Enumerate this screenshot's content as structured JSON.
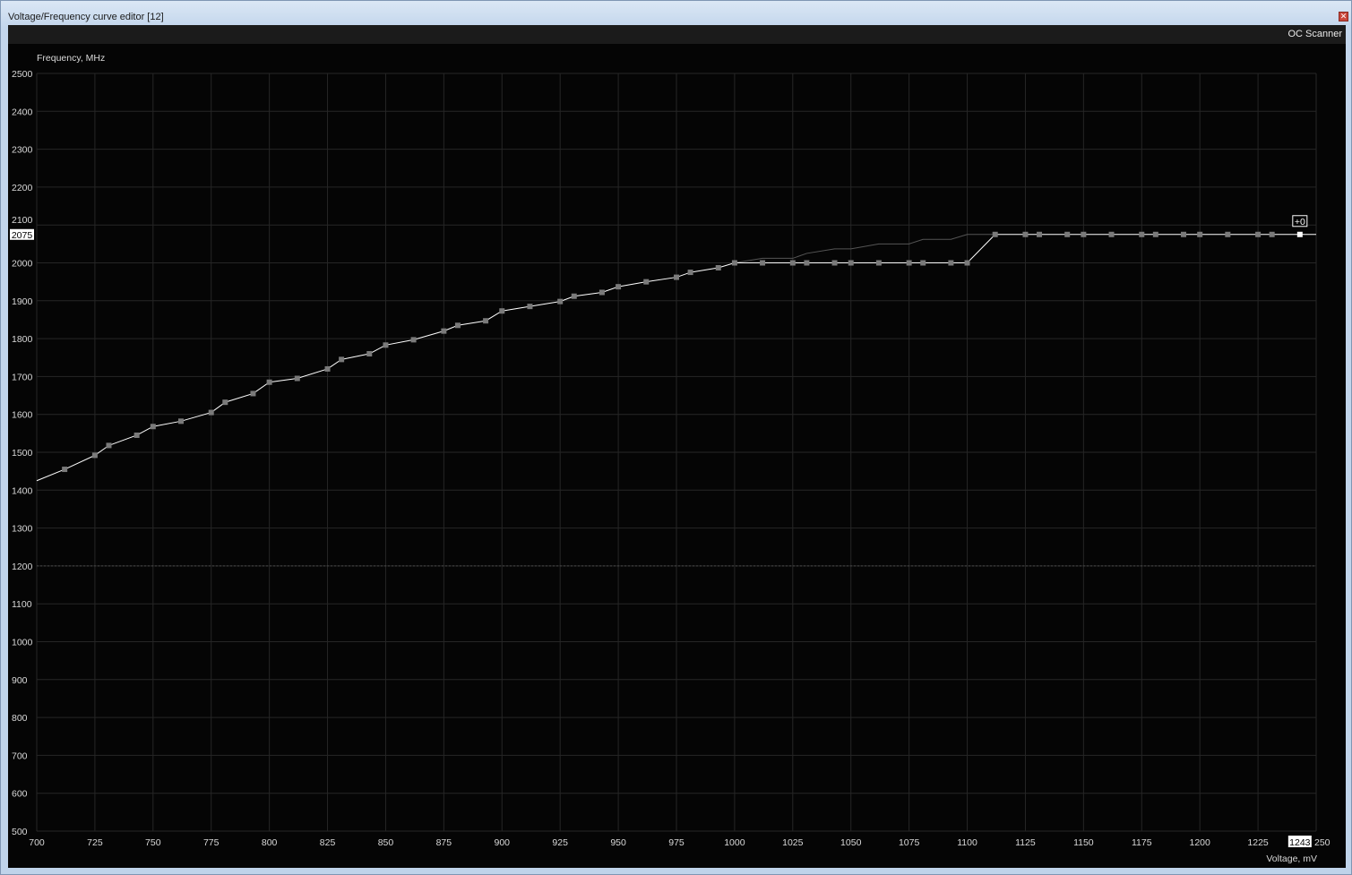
{
  "window": {
    "title": "Voltage/Frequency curve editor [12]",
    "close_glyph": "✕"
  },
  "toolbar": {
    "oc_scanner_label": "OC Scanner"
  },
  "colors": {
    "background": "#050505",
    "grid": "#262626",
    "curve": "#ffffff",
    "default_curve": "#555555",
    "point": "#7a7a7a",
    "selected_point": "#ffffff"
  },
  "chart_data": {
    "type": "line",
    "ylabel": "Frequency, MHz",
    "xlabel": "Voltage, mV",
    "xlim": [
      700,
      1250
    ],
    "ylim": [
      500,
      2500
    ],
    "x_ticks": [
      700,
      725,
      750,
      775,
      800,
      825,
      850,
      875,
      900,
      925,
      950,
      975,
      1000,
      1025,
      1050,
      1075,
      1100,
      1125,
      1150,
      1175,
      1200,
      1225,
      1250
    ],
    "y_ticks": [
      500,
      600,
      700,
      800,
      900,
      1000,
      1100,
      1200,
      1300,
      1400,
      1500,
      1600,
      1700,
      1800,
      1900,
      2000,
      2100,
      2200,
      2300,
      2400,
      2500
    ],
    "grid": true,
    "reference_line_y": 1200,
    "series": [
      {
        "kind": "curve",
        "points": [
          [
            700,
            1425
          ],
          [
            712,
            1455
          ],
          [
            725,
            1492
          ],
          [
            731,
            1518
          ],
          [
            743,
            1545
          ],
          [
            750,
            1568
          ],
          [
            762,
            1582
          ],
          [
            775,
            1605
          ],
          [
            781,
            1632
          ],
          [
            793,
            1655
          ],
          [
            800,
            1685
          ],
          [
            812,
            1695
          ],
          [
            825,
            1720
          ],
          [
            831,
            1745
          ],
          [
            843,
            1760
          ],
          [
            850,
            1783
          ],
          [
            862,
            1797
          ],
          [
            875,
            1820
          ],
          [
            881,
            1835
          ],
          [
            893,
            1847
          ],
          [
            900,
            1873
          ],
          [
            912,
            1885
          ],
          [
            925,
            1898
          ],
          [
            931,
            1912
          ],
          [
            943,
            1922
          ],
          [
            950,
            1937
          ],
          [
            962,
            1950
          ],
          [
            975,
            1962
          ],
          [
            981,
            1975
          ],
          [
            993,
            1987
          ],
          [
            1000,
            2000
          ],
          [
            1012,
            2000
          ],
          [
            1025,
            2000
          ],
          [
            1031,
            2000
          ],
          [
            1043,
            2000
          ],
          [
            1050,
            2000
          ],
          [
            1062,
            2000
          ],
          [
            1075,
            2000
          ],
          [
            1081,
            2000
          ],
          [
            1093,
            2000
          ],
          [
            1100,
            2000
          ],
          [
            1112,
            2075
          ],
          [
            1125,
            2075
          ],
          [
            1131,
            2075
          ],
          [
            1143,
            2075
          ],
          [
            1150,
            2075
          ],
          [
            1162,
            2075
          ],
          [
            1175,
            2075
          ],
          [
            1181,
            2075
          ],
          [
            1193,
            2075
          ],
          [
            1200,
            2075
          ],
          [
            1212,
            2075
          ],
          [
            1225,
            2075
          ],
          [
            1231,
            2075
          ],
          [
            1243,
            2075
          ],
          [
            1250,
            2075
          ]
        ]
      },
      {
        "kind": "default-curve",
        "points": [
          [
            1000,
            2000
          ],
          [
            1012,
            2012
          ],
          [
            1025,
            2012
          ],
          [
            1031,
            2025
          ],
          [
            1043,
            2037
          ],
          [
            1050,
            2037
          ],
          [
            1062,
            2050
          ],
          [
            1075,
            2050
          ],
          [
            1081,
            2062
          ],
          [
            1093,
            2062
          ],
          [
            1100,
            2075
          ],
          [
            1112,
            2075
          ]
        ]
      }
    ],
    "annotations": {
      "current_frequency_label": "2075",
      "current_voltage_label": "1243",
      "offset_label": "+0",
      "selected_point": [
        1243,
        2075
      ]
    }
  }
}
